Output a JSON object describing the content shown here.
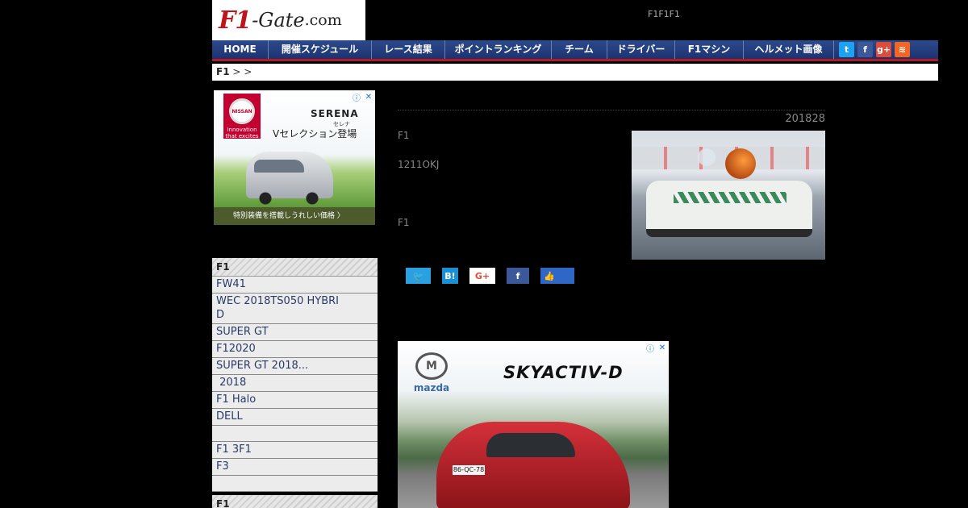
{
  "header": {
    "logo_f1": "F1",
    "logo_gate": "-Gate",
    "logo_com": ".com",
    "tagline": "F1F1F1"
  },
  "nav": {
    "items": [
      {
        "label": "HOME"
      },
      {
        "label": "開催スケジュール"
      },
      {
        "label": "レース結果"
      },
      {
        "label": "ポイントランキング"
      },
      {
        "label": "チーム"
      },
      {
        "label": "ドライバー"
      },
      {
        "label": "F1マシン"
      },
      {
        "label": "ヘルメット画像"
      }
    ],
    "social": [
      {
        "icon": "twitter-icon",
        "glyph": "t",
        "color": "#1da1f2"
      },
      {
        "icon": "facebook-icon",
        "glyph": "f",
        "color": "#3b5998"
      },
      {
        "icon": "google-plus-icon",
        "glyph": "g+",
        "color": "#dd4b39"
      },
      {
        "icon": "rss-icon",
        "glyph": "≋",
        "color": "#f26522"
      }
    ]
  },
  "breadcrumb": {
    "home": "F1",
    "sep1": " > ",
    "sep2": " > "
  },
  "ad_top": {
    "maker": "NISSAN",
    "maker_sub": "Innovation that excites",
    "model": "SERENA",
    "model_sub": "セレナ",
    "copy": "Vセレクション登場",
    "bar_text": "特別装備を搭載しうれしい価格 〉",
    "info_glyph": "ⓘ",
    "close_glyph": "✕"
  },
  "sidebar": {
    "section1_title": "F1",
    "items": [
      {
        "label": "FW41"
      },
      {
        "label": "WEC 2018TS050 HYBRID"
      },
      {
        "label": "SUPER GT"
      },
      {
        "label": "F12020"
      },
      {
        "label": "SUPER GT 2018..."
      },
      {
        "label": " 2018"
      },
      {
        "label": "F1 Halo"
      },
      {
        "label": "DELL"
      },
      {
        "label": ""
      },
      {
        "label": "F1 3F1"
      },
      {
        "label": "F3"
      },
      {
        "label": ""
      }
    ],
    "section2_title": "F1"
  },
  "article": {
    "date": "201828",
    "para1": "F1",
    "para2": "1211OKJ",
    "para3": "F1"
  },
  "share": {
    "twitter": "🐦",
    "hatena": "B!",
    "google": "G+",
    "facebook": "f",
    "like": "👍"
  },
  "ad_bottom": {
    "maker": "mazda",
    "headline": "SKYACTIV-D",
    "plate": "86-QC-78",
    "info_glyph": "ⓘ",
    "close_glyph": "✕"
  }
}
